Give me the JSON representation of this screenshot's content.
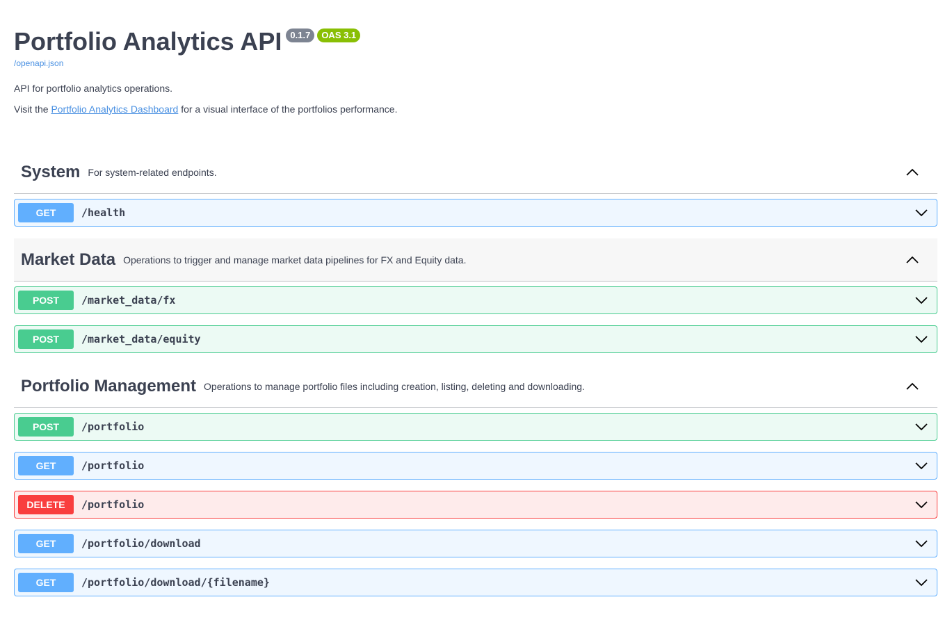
{
  "info": {
    "title": "Portfolio Analytics API",
    "version": "0.1.7",
    "oas": "OAS 3.1",
    "openapi_link": "/openapi.json",
    "description": "API for portfolio analytics operations.",
    "visit_prefix": "Visit the ",
    "dashboard_link": "Portfolio Analytics Dashboard",
    "visit_suffix": " for a visual interface of the portfolios performance."
  },
  "sections": [
    {
      "name": "System",
      "description": "For system-related endpoints.",
      "operations": [
        {
          "method": "GET",
          "path": "/health"
        }
      ]
    },
    {
      "name": "Market Data",
      "description": "Operations to trigger and manage market data pipelines for FX and Equity data.",
      "operations": [
        {
          "method": "POST",
          "path": "/market_data/fx"
        },
        {
          "method": "POST",
          "path": "/market_data/equity"
        }
      ]
    },
    {
      "name": "Portfolio Management",
      "description": "Operations to manage portfolio files including creation, listing, deleting and downloading.",
      "operations": [
        {
          "method": "POST",
          "path": "/portfolio"
        },
        {
          "method": "GET",
          "path": "/portfolio"
        },
        {
          "method": "DELETE",
          "path": "/portfolio"
        },
        {
          "method": "GET",
          "path": "/portfolio/download"
        },
        {
          "method": "GET",
          "path": "/portfolio/download/{filename}"
        }
      ]
    }
  ],
  "colors": {
    "get": "#61affe",
    "post": "#49cc90",
    "delete": "#f93e3e",
    "link": "#4990e2",
    "version_badge": "#7d8492",
    "oas_badge": "#89bf04"
  },
  "icons": {
    "section_toggle": "chevron-up-icon",
    "operation_toggle": "chevron-down-icon"
  }
}
